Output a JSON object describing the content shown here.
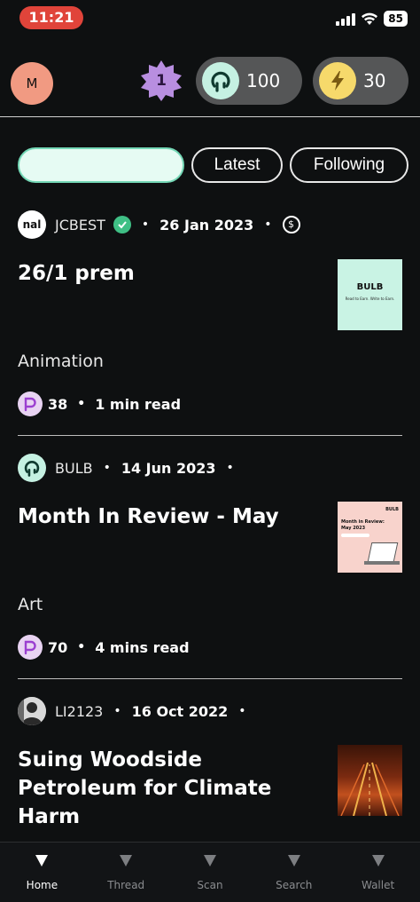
{
  "status_bar": {
    "time": "11:21",
    "battery": "85"
  },
  "header": {
    "avatar_initial": "M",
    "level": "1",
    "bulb_balance": "100",
    "energy_balance": "30"
  },
  "filters": {
    "search_value": "",
    "latest_label": "Latest",
    "following_label": "Following"
  },
  "articles": [
    {
      "author_avatar_text": "nal",
      "author": "JCBEST",
      "date": "26 Jan 2023",
      "title": "26/1 prem",
      "category": "Animation",
      "points": "38",
      "read_time": "1 min read",
      "thumb": {
        "brand": "BULB",
        "tagline": "Read to Earn. Write to Earn."
      },
      "verified": true,
      "paid": true
    },
    {
      "author": "BULB",
      "date": "14 Jun 2023",
      "title": "Month In Review - May",
      "category": "Art",
      "points": "70",
      "read_time": "4 mins read",
      "thumb": {
        "brand": "BULB",
        "heading": "Month in Review:",
        "subheading": "May 2023"
      }
    },
    {
      "author": "LI2123",
      "date": "16 Oct 2022",
      "title": "Suing Woodside Petroleum for Climate Harm"
    }
  ],
  "nav": {
    "items": [
      {
        "label": "Home",
        "icon": "home-triangle-icon",
        "active": true
      },
      {
        "label": "Thread",
        "icon": "thread-triangle-icon",
        "active": false
      },
      {
        "label": "Scan",
        "icon": "scan-triangle-icon",
        "active": false
      },
      {
        "label": "Search",
        "icon": "search-triangle-icon",
        "active": false
      },
      {
        "label": "Wallet",
        "icon": "wallet-triangle-icon",
        "active": false
      }
    ]
  },
  "colors": {
    "background": "#0e1011",
    "accent_mint": "#c5f1e2",
    "accent_yellow": "#f6d96b",
    "accent_purple": "#b88ee0",
    "verified_green": "#3fbf85",
    "time_pill_red": "#e0443a"
  }
}
